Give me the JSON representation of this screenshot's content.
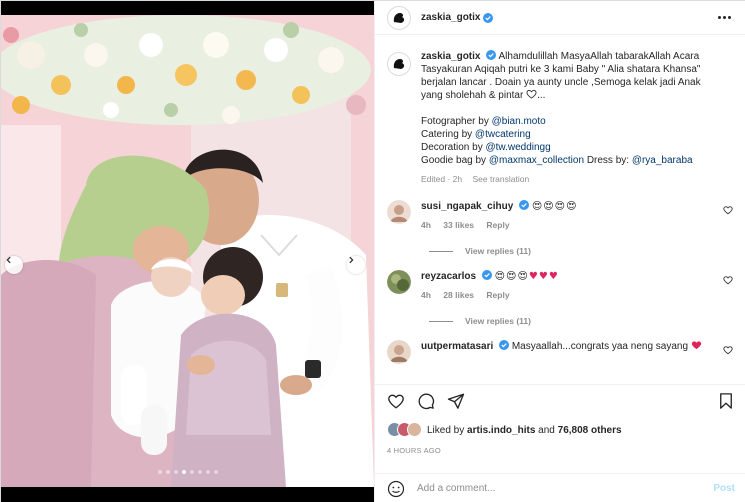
{
  "post": {
    "username": "zaskia_gotix",
    "verified": true,
    "more_icon": "more-horizontal-icon"
  },
  "caption": {
    "username": "zaskia_gotix",
    "text_1": "Alhamdulillah MasyaAllah tabarakAllah Acara Tasyakuran Aqiqah putri ke 3 kami Baby \" Alia shatara Khansa\" berjalan lancar . Doain ya aunty uncle ,Semoga kelak jadi Anak yang sholehah & pintar",
    "text_1_end": "...",
    "credit_photo_label": "Fotographer by",
    "credit_photo_link": "@bian.moto",
    "credit_catering_label": "Catering by",
    "credit_catering_link": "@twcatering",
    "credit_decoration_label": "Decoration by",
    "credit_decoration_link": "@tw.weddingg",
    "credit_goodie_label": "Goodie bag by",
    "credit_goodie_link": "@maxmax_collection",
    "credit_dress_label": "Dress by:",
    "credit_dress_link": "@rya_baraba",
    "edited": "Edited · 2h",
    "see_translation": "See translation"
  },
  "comments": [
    {
      "username": "susi_ngapak_cihuy",
      "verified": true,
      "text": "😍😍😍😍",
      "time": "4h",
      "likes": "33 likes",
      "reply": "Reply",
      "view_replies": "View replies (11)",
      "avatar_color": "#d9c2b8"
    },
    {
      "username": "reyzacarlos",
      "verified": true,
      "text": "😍😍😍",
      "hearts": "♥♥♥",
      "time": "4h",
      "likes": "28 likes",
      "reply": "Reply",
      "view_replies": "View replies (11)",
      "avatar_color": "#6b7f4f"
    },
    {
      "username": "uutpermatasari",
      "verified": true,
      "text": "Masyaallah...congrats yaa neng sayang",
      "avatar_color": "#c9a58f"
    }
  ],
  "actions": {
    "like_icon": "heart-icon",
    "comment_icon": "comment-icon",
    "share_icon": "share-icon",
    "save_icon": "bookmark-icon"
  },
  "likes": {
    "label": "Liked by",
    "liker": "artis.indo_hits",
    "and": "and",
    "others": "76,808 others"
  },
  "timestamp": "4 HOURS AGO",
  "add_comment": {
    "placeholder": "Add a comment...",
    "post_label": "Post"
  },
  "carousel": {
    "total": 8,
    "active": 3
  }
}
